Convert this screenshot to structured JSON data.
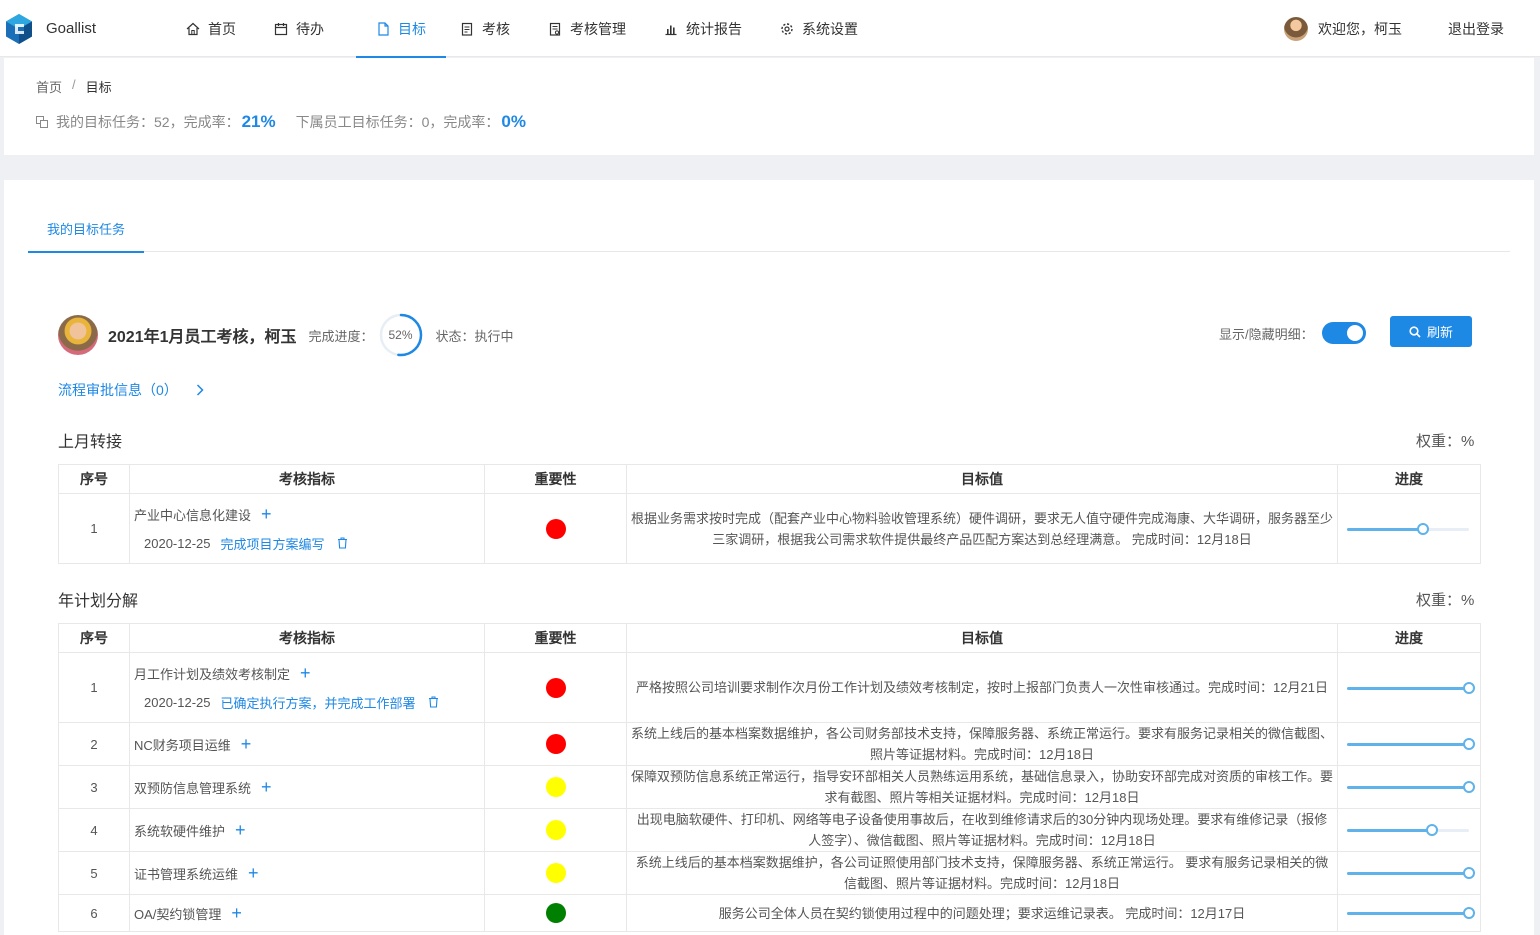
{
  "header": {
    "app_name": "Goallist",
    "nav": [
      {
        "label": "首页",
        "icon": "home-icon"
      },
      {
        "label": "待办",
        "icon": "calendar-icon"
      },
      {
        "label": "目标",
        "icon": "document-icon",
        "active": true
      },
      {
        "label": "考核",
        "icon": "clipboard-icon"
      },
      {
        "label": "考核管理",
        "icon": "clipboard-manage-icon"
      },
      {
        "label": "统计报告",
        "icon": "bar-chart-icon"
      },
      {
        "label": "系统设置",
        "icon": "gear-icon"
      }
    ],
    "welcome": "欢迎您，柯玉",
    "logout": "退出登录"
  },
  "breadcrumb": {
    "home": "首页",
    "sep": "/",
    "current": "目标"
  },
  "summary": {
    "my_label": "我的目标任务：52，完成率：",
    "my_rate": "21%",
    "sub_label": "下属员工目标任务：0，完成率：",
    "sub_rate": "0%"
  },
  "tabs": [
    {
      "label": "我的目标任务"
    }
  ],
  "task": {
    "title": "2021年1月员工考核，柯玉",
    "progress_label": "完成进度：",
    "progress_value": "52%",
    "progress_fraction": 0.52,
    "status": "状态：执行中",
    "toggle_label": "显示/隐藏明细：",
    "toggle_on": true,
    "refresh_label": "刷新",
    "flow_link": "流程审批信息（0）"
  },
  "columns": [
    "序号",
    "考核指标",
    "重要性",
    "目标值",
    "进度"
  ],
  "colors": {
    "red": "#ff0000",
    "yellow": "#ffff00",
    "green": "#008000",
    "accent": "#1e88e5"
  },
  "sections": [
    {
      "title": "上月转接",
      "weight": "权重：%",
      "rows": [
        {
          "index": "1",
          "indicator": "产业中心信息化建设",
          "sub_date": "2020-12-25",
          "sub_text": "完成项目方案编写",
          "importance": "red",
          "target": "根据业务需求按时完成（配套产业中心物料验收管理系统）硬件调研，要求无人值守硬件完成海康、大华调研，服务器至少三家调研，根据我公司需求软件提供最终产品匹配方案达到总经理满意。 完成时间：12月18日",
          "progress": 0.62
        }
      ]
    },
    {
      "title": "年计划分解",
      "weight": "权重：%",
      "rows": [
        {
          "index": "1",
          "indicator": "月工作计划及绩效考核制定",
          "sub_date": "2020-12-25",
          "sub_text": "已确定执行方案，并完成工作部署",
          "importance": "red",
          "target": "严格按照公司培训要求制作次月份工作计划及绩效考核制定，按时上报部门负责人一次性审核通过。完成时间：12月21日",
          "progress": 1.0
        },
        {
          "index": "2",
          "indicator": "NC财务项目运维",
          "importance": "red",
          "target": "系统上线后的基本档案数据维护，各公司财务部技术支持，保障服务器、系统正常运行。要求有服务记录相关的微信截图、照片等证据材料。完成时间：12月18日",
          "progress": 1.0
        },
        {
          "index": "3",
          "indicator": "双预防信息管理系统",
          "importance": "yellow",
          "target": "保障双预防信息系统正常运行，指导安环部相关人员熟练运用系统，基础信息录入，协助安环部完成对资质的审核工作。要求有截图、照片等相关证据材料。完成时间：12月18日",
          "progress": 1.0
        },
        {
          "index": "4",
          "indicator": "系统软硬件维护",
          "importance": "yellow",
          "target": "出现电脑软硬件、打印机、网络等电子设备使用事故后，在收到维修请求后的30分钟内现场处理。要求有维修记录（报修人签字）、微信截图、照片等证据材料。完成时间：12月18日",
          "progress": 0.7
        },
        {
          "index": "5",
          "indicator": "证书管理系统运维",
          "importance": "yellow",
          "target": "系统上线后的基本档案数据维护，各公司证照使用部门技术支持，保障服务器、系统正常运行。 要求有服务记录相关的微信截图、照片等证据材料。完成时间：12月18日",
          "progress": 1.0
        },
        {
          "index": "6",
          "indicator": "OA/契约锁管理",
          "importance": "green",
          "target": "服务公司全体人员在契约锁使用过程中的问题处理；要求运维记录表。 完成时间：12月17日",
          "progress": 1.0
        }
      ]
    }
  ]
}
